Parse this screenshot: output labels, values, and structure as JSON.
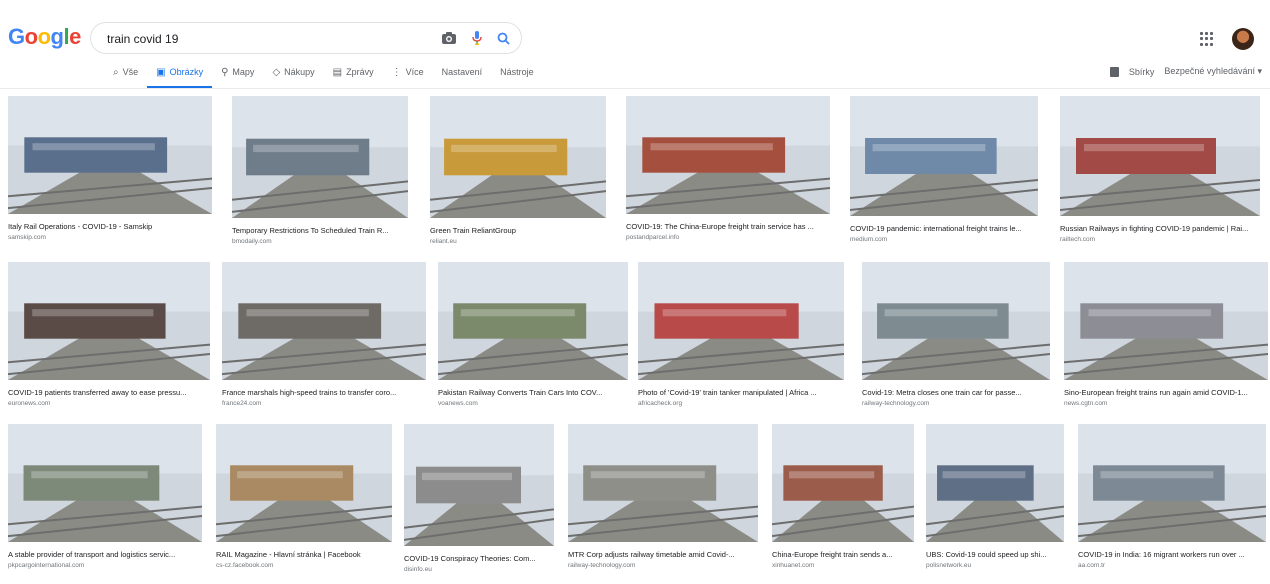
{
  "header": {
    "logo": [
      "G",
      "o",
      "o",
      "g",
      "l",
      "e"
    ],
    "query": "train covid 19"
  },
  "tabs": [
    {
      "label": "Vše",
      "icon": "search-icon",
      "active": false
    },
    {
      "label": "Obrázky",
      "icon": "image-icon",
      "active": true
    },
    {
      "label": "Mapy",
      "icon": "map-pin-icon",
      "active": false
    },
    {
      "label": "Nákupy",
      "icon": "tag-icon",
      "active": false
    },
    {
      "label": "Zprávy",
      "icon": "news-icon",
      "active": false
    },
    {
      "label": "Více",
      "icon": "more-vert-icon",
      "active": false
    },
    {
      "label": "Nastavení",
      "icon": "",
      "active": false
    },
    {
      "label": "Nástroje",
      "icon": "",
      "active": false
    }
  ],
  "tools_right": {
    "collections": "Sbírky",
    "safe_search": "Bezpečné vyhledávání"
  },
  "results": [
    {
      "caption": "Italy Rail Operations - COVID-19 - Samskip",
      "source": "samskip.com",
      "color": "#5a6f8c"
    },
    {
      "caption": "Temporary Restrictions To Scheduled Train R...",
      "source": "bmodaily.com",
      "color": "#6f7c8a"
    },
    {
      "caption": "Green Train ReliantGroup",
      "source": "reliant.eu",
      "color": "#c89a3a"
    },
    {
      "caption": "COVID-19: The China-Europe freight train service has ...",
      "source": "postandparcel.info",
      "color": "#a5503e"
    },
    {
      "caption": "COVID-19 pandemic: international freight trains le...",
      "source": "medium.com",
      "color": "#6f8aa8"
    },
    {
      "caption": "Russian Railways in fighting COVID-19 pandemic | Rai...",
      "source": "railtech.com",
      "color": "#a24a45"
    },
    {
      "caption": "COVID-19 patients transferred away to ease pressu...",
      "source": "euronews.com",
      "color": "#5b4b47"
    },
    {
      "caption": "France marshals high-speed trains to transfer coro...",
      "source": "france24.com",
      "color": "#6e6a66"
    },
    {
      "caption": "Pakistan Railway Converts Train Cars Into COV...",
      "source": "voanews.com",
      "color": "#7b8a6b"
    },
    {
      "caption": "Photo of 'Covid-19' train tanker manipulated | Africa ...",
      "source": "africacheck.org",
      "color": "#b84a4a"
    },
    {
      "caption": "Covid-19: Metra closes one train car for passe...",
      "source": "railway-technology.com",
      "color": "#7e8c92"
    },
    {
      "caption": "Sino-European freight trains run again amid COVID-1...",
      "source": "news.cgtn.com",
      "color": "#8d8e95"
    },
    {
      "caption": "A stable provider of transport and logistics servic...",
      "source": "pkpcargointernational.com",
      "color": "#7d8a7a"
    },
    {
      "caption": "RAIL Magazine - Hlavní stránka | Facebook",
      "source": "cs-cz.facebook.com",
      "color": "#a98a62"
    },
    {
      "caption": "COVID-19 Conspiracy Theories: Com...",
      "source": "disinfo.eu",
      "color": "#8c8c8c"
    },
    {
      "caption": "MTR Corp adjusts railway timetable amid Covid-...",
      "source": "railway-technology.com",
      "color": "#8e8f88"
    },
    {
      "caption": "China-Europe freight train sends a...",
      "source": "xinhuanet.com",
      "color": "#9b5c4b"
    },
    {
      "caption": "UBS: Covid-19 could speed up shi...",
      "source": "polisnetwork.eu",
      "color": "#5f6f86"
    },
    {
      "caption": "COVID-19 in India: 16 migrant workers run over ...",
      "source": "aa.com.tr",
      "color": "#7d8a96"
    }
  ]
}
